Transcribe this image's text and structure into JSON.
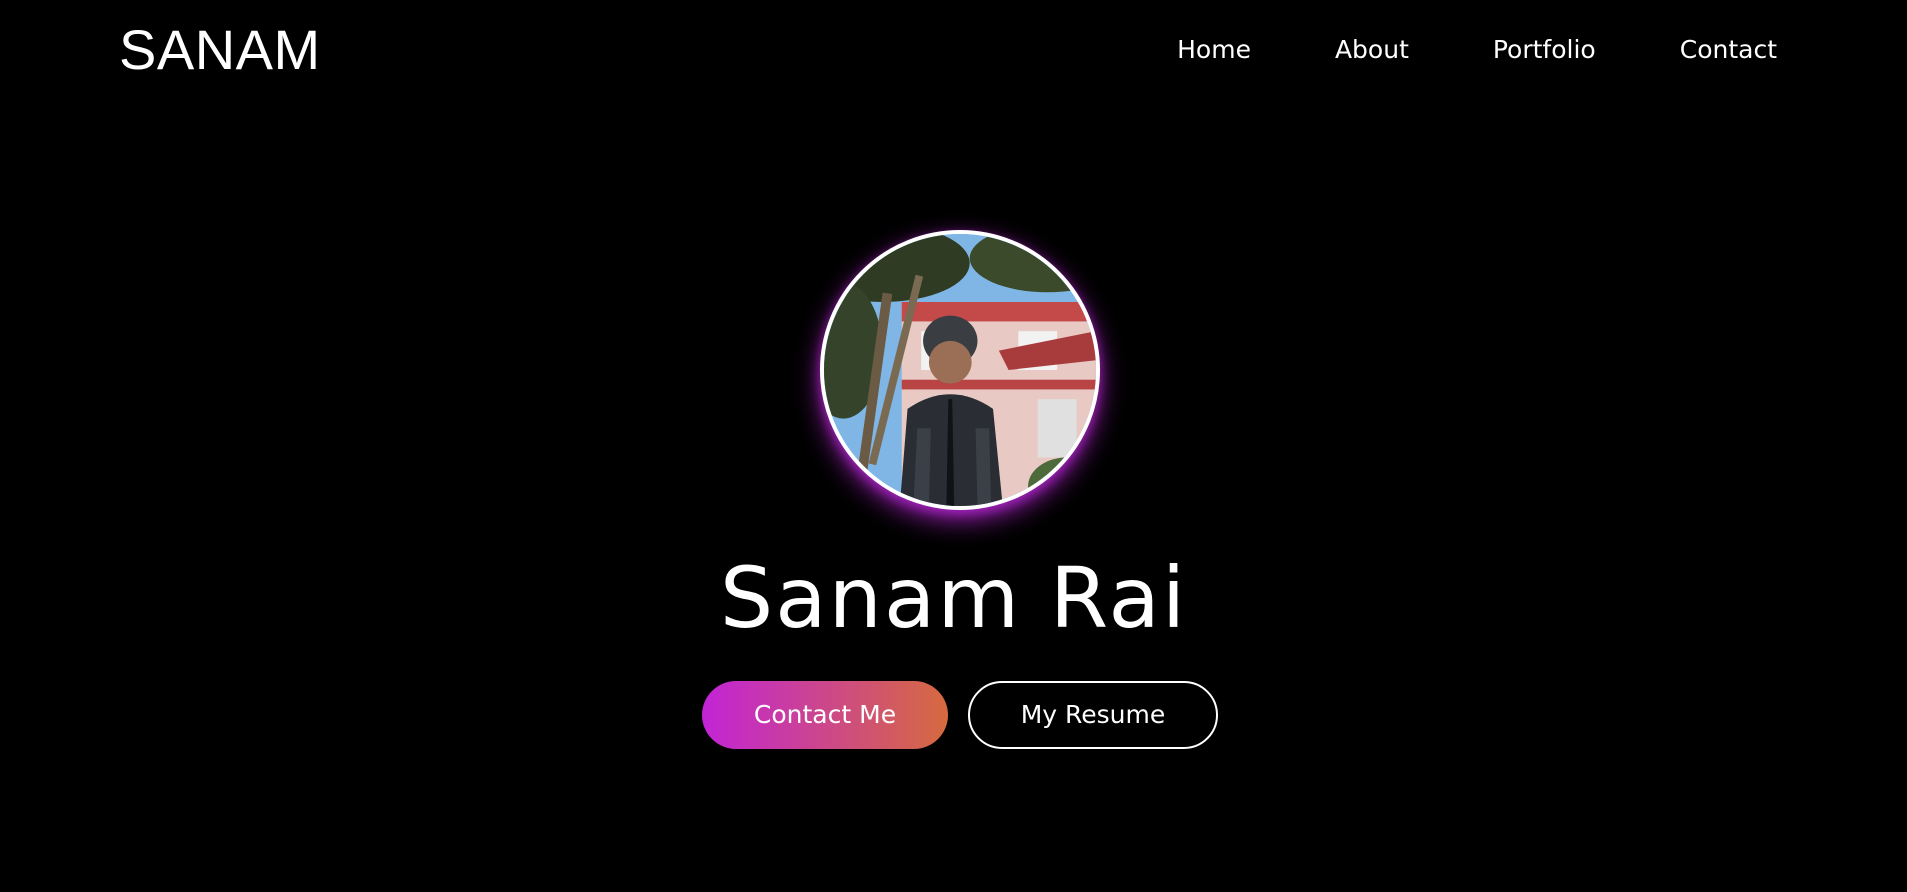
{
  "brand": {
    "logo_text": "SANAM"
  },
  "nav": {
    "items": [
      {
        "label": "Home"
      },
      {
        "label": "About"
      },
      {
        "label": "Portfolio"
      },
      {
        "label": "Contact"
      }
    ]
  },
  "hero": {
    "name": "Sanam Rai",
    "contact_button": "Contact Me",
    "resume_button": "My Resume"
  },
  "colors": {
    "background": "#000000",
    "text": "#ffffff",
    "gradient_start": "#c224d6",
    "gradient_end": "#d66a3f",
    "avatar_glow": "#be28dc"
  }
}
